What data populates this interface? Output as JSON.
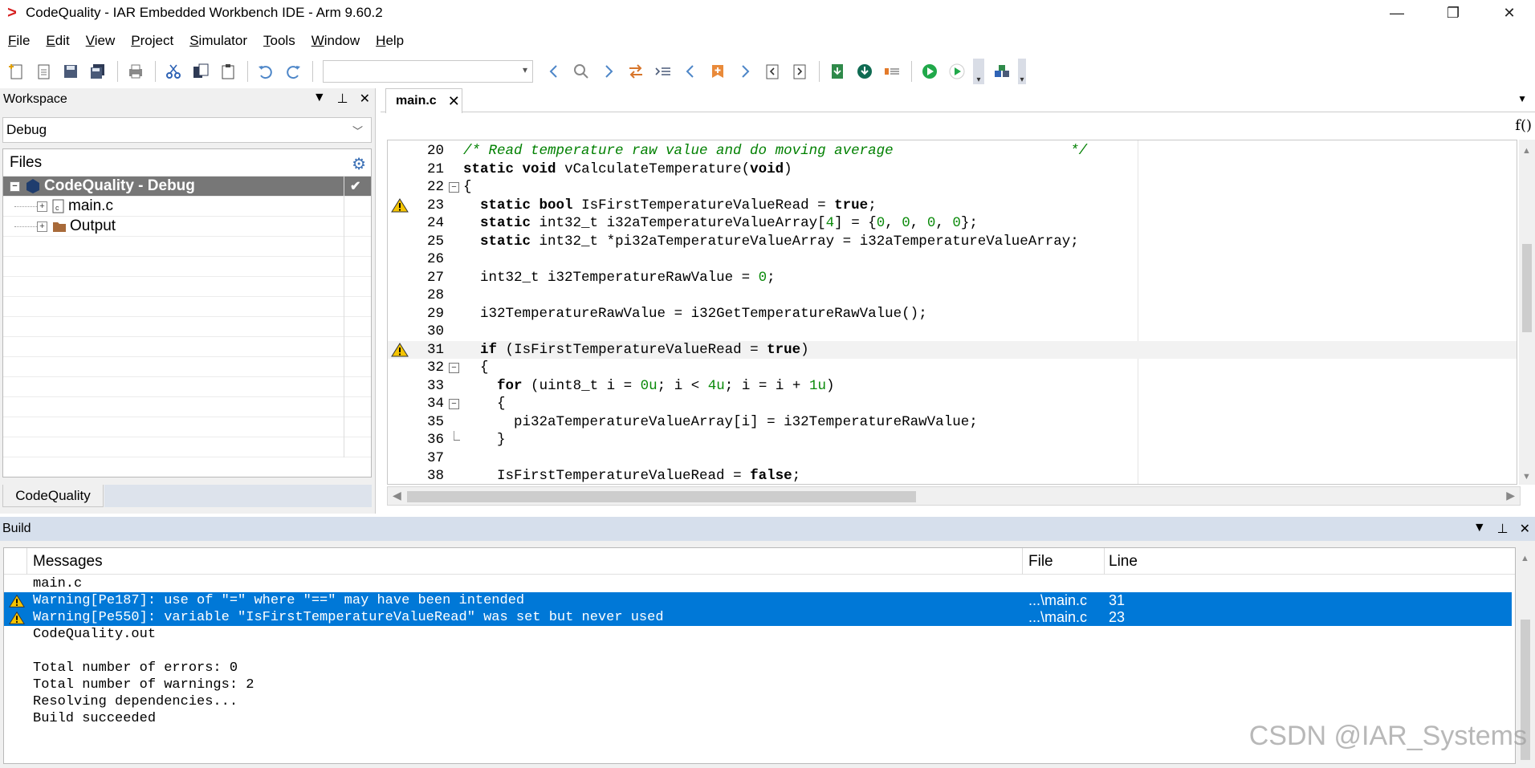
{
  "window": {
    "title": "CodeQuality - IAR Embedded Workbench IDE - Arm 9.60.2",
    "controls": {
      "minimize": "—",
      "restore": "❐",
      "close": "✕"
    }
  },
  "menu": [
    "File",
    "Edit",
    "View",
    "Project",
    "Simulator",
    "Tools",
    "Window",
    "Help"
  ],
  "toolbar": {
    "combo_value": "",
    "icons": [
      "new-file-icon",
      "open-file-icon",
      "save-icon",
      "save-all-icon",
      "print-icon",
      "cut-icon",
      "copy-icon",
      "paste-icon",
      "undo-icon",
      "redo-icon",
      "nav-back-icon",
      "find-icon",
      "nav-forward-icon",
      "replace-icon",
      "go-to-icon",
      "prev-bookmark-icon",
      "toggle-bookmark-icon",
      "next-bookmark-icon",
      "prev-error-icon",
      "next-error-icon",
      "compile-icon",
      "download-debug-icon",
      "stop-build-icon",
      "make-icon",
      "debug-without-download-icon",
      "toolbar-options-icon"
    ]
  },
  "workspace": {
    "title": "Workspace",
    "configuration": "Debug",
    "files_header": "Files",
    "project": "CodeQuality - Debug",
    "items": [
      "main.c",
      "Output"
    ],
    "tab": "CodeQuality"
  },
  "editor": {
    "tab": "main.c",
    "lines": [
      {
        "n": "20",
        "code": "/* Read temperature raw value and do moving average                     */"
      },
      {
        "n": "21",
        "code": "static void vCalculateTemperature(void)"
      },
      {
        "n": "22",
        "code": "{"
      },
      {
        "n": "23",
        "code": "  static bool IsFirstTemperatureValueRead = true;",
        "warning": true
      },
      {
        "n": "24",
        "code": "  static int32_t i32aTemperatureValueArray[4] = {0, 0, 0, 0};"
      },
      {
        "n": "25",
        "code": "  static int32_t *pi32aTemperatureValueArray = i32aTemperatureValueArray;"
      },
      {
        "n": "26",
        "code": ""
      },
      {
        "n": "27",
        "code": "  int32_t i32TemperatureRawValue = 0;"
      },
      {
        "n": "28",
        "code": ""
      },
      {
        "n": "29",
        "code": "  i32TemperatureRawValue = i32GetTemperatureRawValue();"
      },
      {
        "n": "30",
        "code": ""
      },
      {
        "n": "31",
        "code": "  if (IsFirstTemperatureValueRead = true)",
        "warning": true
      },
      {
        "n": "32",
        "code": "  {"
      },
      {
        "n": "33",
        "code": "    for (uint8_t i = 0u; i < 4u; i = i + 1u)"
      },
      {
        "n": "34",
        "code": "    {"
      },
      {
        "n": "35",
        "code": "      pi32aTemperatureValueArray[i] = i32TemperatureRawValue;"
      },
      {
        "n": "36",
        "code": "    }"
      },
      {
        "n": "37",
        "code": ""
      },
      {
        "n": "38",
        "code": "    IsFirstTemperatureValueRead = false;"
      }
    ]
  },
  "build": {
    "title": "Build",
    "columns": {
      "messages": "Messages",
      "file": "File",
      "line": "Line"
    },
    "rows": [
      {
        "msg": "main.c",
        "file": "",
        "line": ""
      },
      {
        "msg": "Warning[Pe187]: use of \"=\" where \"==\" may have been intended",
        "file": "...\\main.c",
        "line": "31",
        "selected": true,
        "warning": true
      },
      {
        "msg": "Warning[Pe550]: variable \"IsFirstTemperatureValueRead\" was set but never used",
        "file": "...\\main.c",
        "line": "23",
        "selected": true,
        "warning": true
      },
      {
        "msg": "CodeQuality.out",
        "file": "",
        "line": ""
      },
      {
        "msg": "",
        "file": "",
        "line": ""
      },
      {
        "msg": "Total number of errors: 0",
        "file": "",
        "line": ""
      },
      {
        "msg": "Total number of warnings: 2",
        "file": "",
        "line": ""
      },
      {
        "msg": "Resolving dependencies...",
        "file": "",
        "line": ""
      },
      {
        "msg": "Build succeeded",
        "file": "",
        "line": ""
      }
    ]
  },
  "watermark": "CSDN @IAR_Systems",
  "colors": {
    "selection": "#0078d7",
    "comment": "#008000",
    "number": "#0a8a0a",
    "panel_header": "#d6dfec"
  }
}
